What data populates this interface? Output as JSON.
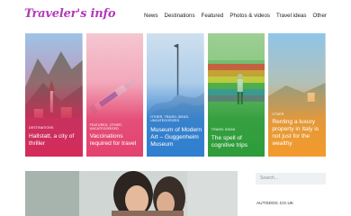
{
  "site": {
    "logo": "Traveler's info"
  },
  "nav": [
    {
      "label": "News"
    },
    {
      "label": "Destinations"
    },
    {
      "label": "Featured"
    },
    {
      "label": "Photos & videos"
    },
    {
      "label": "Travel ideas"
    },
    {
      "label": "Other"
    }
  ],
  "cards": [
    {
      "category": "Destinations",
      "title": "Hallstatt, a city of thriller",
      "colors": {
        "top": "#f24a6a",
        "bottom": "#d52b5a"
      }
    },
    {
      "category": "Featured, Other, Uncategorized",
      "title": "Vaccinations required for travel",
      "colors": {
        "top": "#f06a8e",
        "bottom": "#e3426e"
      }
    },
    {
      "category": "Other, Travel ideas, Uncategorized",
      "title": "Museum of Modern Art – Guggenheim Museum",
      "colors": {
        "top": "#6aa6dc",
        "bottom": "#2f7fd0"
      }
    },
    {
      "category": "Travel ideas",
      "title": "The spell of cognitive trips",
      "colors": {
        "top": "#46b04a",
        "bottom": "#2e9c3a"
      }
    },
    {
      "category": "Other",
      "title": "Renting a luxury property in Italy is not just for the wealthy",
      "colors": {
        "top": "#f6b85a",
        "bottom": "#f39a2c"
      }
    }
  ],
  "search": {
    "placeholder": "Search..."
  },
  "sidebar": {
    "link": "AUTODOC.CO.UK"
  }
}
